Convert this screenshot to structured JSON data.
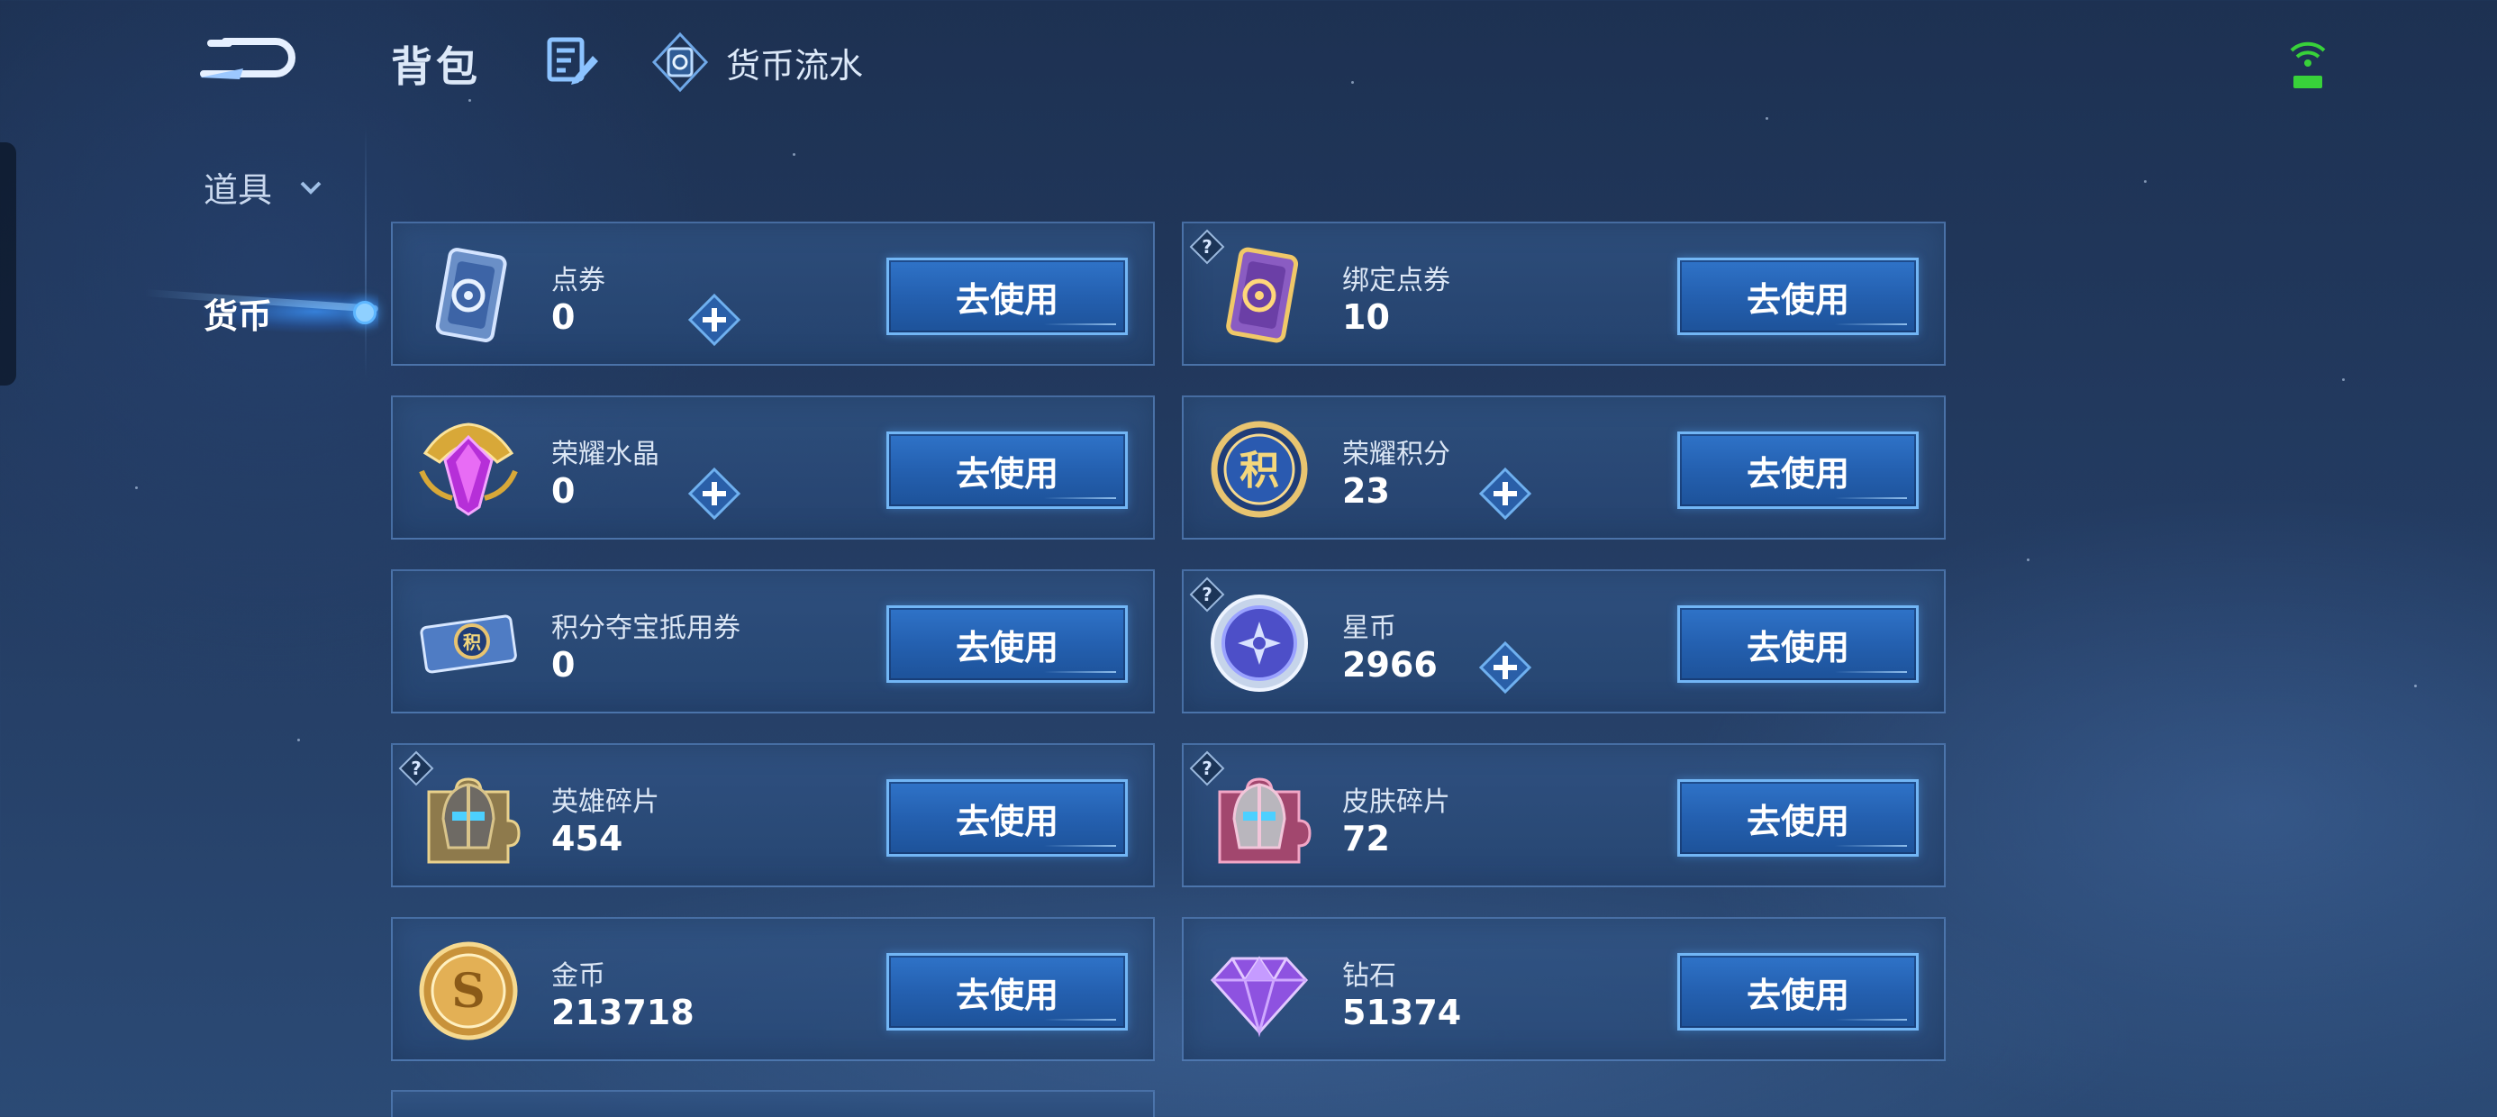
{
  "header": {
    "title": "背包",
    "flow_link_label": "货币流水"
  },
  "sidebar": {
    "items": [
      {
        "label": "道具",
        "expandable": true,
        "selected": false
      },
      {
        "label": "货币",
        "selected": true
      }
    ]
  },
  "currencies": [
    {
      "name": "点券",
      "amount": "0",
      "icon": "voucher-blue-icon",
      "has_plus": true,
      "has_help": false,
      "button_label": "去使用"
    },
    {
      "name": "绑定点券",
      "amount": "10",
      "icon": "voucher-gold-icon",
      "has_plus": false,
      "has_help": true,
      "button_label": "去使用"
    },
    {
      "name": "荣耀水晶",
      "amount": "0",
      "icon": "glory-crystal-icon",
      "has_plus": true,
      "has_help": false,
      "button_label": "去使用"
    },
    {
      "name": "荣耀积分",
      "amount": "23",
      "icon": "glory-points-icon",
      "has_plus": true,
      "has_help": false,
      "button_label": "去使用"
    },
    {
      "name": "积分夺宝抵用券",
      "amount": "0",
      "icon": "points-coupon-icon",
      "has_plus": false,
      "has_help": false,
      "button_label": "去使用"
    },
    {
      "name": "星币",
      "amount": "2966",
      "icon": "star-coin-icon",
      "has_plus": true,
      "has_help": true,
      "button_label": "去使用"
    },
    {
      "name": "英雄碎片",
      "amount": "454",
      "icon": "hero-fragment-icon",
      "has_plus": false,
      "has_help": true,
      "button_label": "去使用"
    },
    {
      "name": "皮肤碎片",
      "amount": "72",
      "icon": "skin-fragment-icon",
      "has_plus": false,
      "has_help": true,
      "button_label": "去使用"
    },
    {
      "name": "金币",
      "amount": "213718",
      "icon": "gold-coin-icon",
      "has_plus": false,
      "has_help": false,
      "button_label": "去使用"
    },
    {
      "name": "钻石",
      "amount": "51374",
      "icon": "diamond-icon",
      "has_plus": false,
      "has_help": false,
      "button_label": "去使用"
    }
  ],
  "colors": {
    "background": "#233b61",
    "button": "#2460b0",
    "button_border": "#72b6f5",
    "status_green": "#38d23a"
  }
}
